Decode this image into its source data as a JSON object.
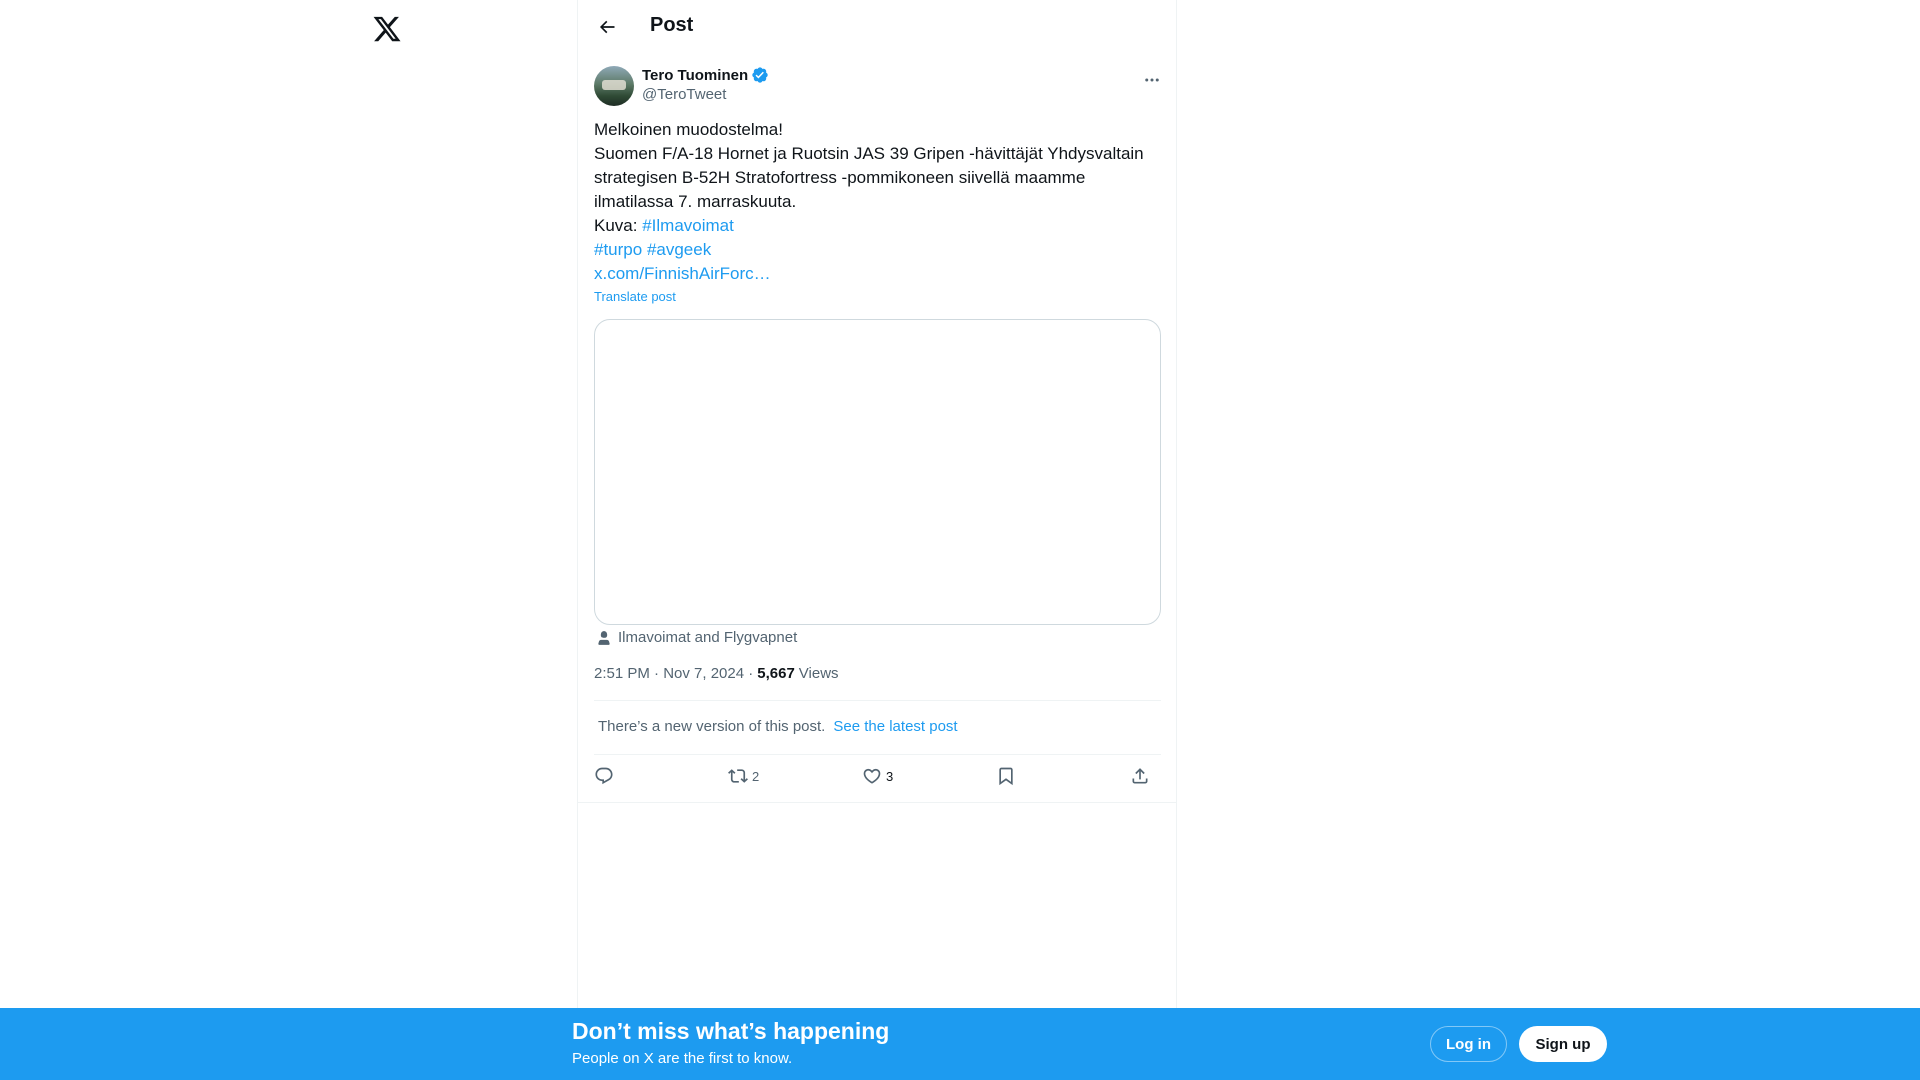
{
  "header": {
    "title": "Post"
  },
  "author": {
    "name": "Tero Tuominen",
    "handle": "@TeroTweet"
  },
  "tweet": {
    "lines": [
      "Melkoinen muodostelma!",
      "Suomen F/A-18 Hornet ja Ruotsin JAS 39 Gripen -hävittäjät Yhdysvaltain",
      "strategisen B-52H Stratofortress -pommikoneen siivellä maamme",
      "ilmatilassa 7. marraskuuta."
    ],
    "kuva_prefix": "Kuva: ",
    "hashtag_ilmavoimat": "#Ilmavoimat",
    "hashtag_turpo": "#turpo",
    "hashtag_avgeek": "#avgeek",
    "link": "x.com/FinnishAirForc…",
    "translate": "Translate post"
  },
  "tagged": {
    "text": "Ilmavoimat and Flygvapnet"
  },
  "meta": {
    "timestamp": "2:51 PM · Nov 7, 2024 ·",
    "views_count": "5,667",
    "views_label": "Views"
  },
  "notice": {
    "text": "There’s a new version of this post.",
    "link": "See the latest post"
  },
  "actions": {
    "reply_count": "",
    "retweet_count": "2",
    "like_count": "3"
  },
  "banner": {
    "title": "Don’t miss what’s happening",
    "subtitle": "People on X are the first to know.",
    "login": "Log in",
    "signup": "Sign up"
  },
  "colors": {
    "accent": "#1d9bf0",
    "text": "#0f1419",
    "secondary": "#536471"
  }
}
